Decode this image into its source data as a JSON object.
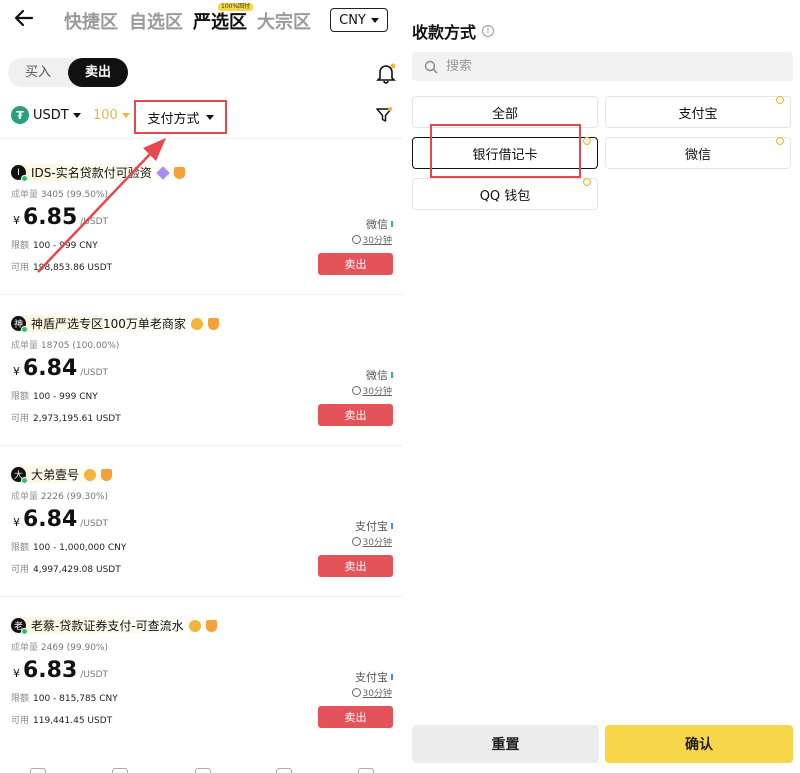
{
  "nav": {
    "tabs": [
      "快捷区",
      "自选区",
      "严选区",
      "大宗区"
    ],
    "active_tab": "严选区",
    "badge": "100%回付",
    "currency": "CNY"
  },
  "trade_toggle": {
    "buy": "买入",
    "sell": "卖出"
  },
  "filters": {
    "asset": "USDT",
    "amount": "100",
    "payment": "支付方式"
  },
  "ads": [
    {
      "avatar": "I",
      "name": "IDS-实名贷款付可验资",
      "stats_label": "成单量",
      "stats": "3405 (99.50%)",
      "currency_symbol": "¥",
      "price": "6.85",
      "unit": "/USDT",
      "limit_label": "限额",
      "limit": "100 - 999 CNY",
      "avail_label": "可用",
      "avail": "198,853.86 USDT",
      "method": "微信",
      "time": "30分钟",
      "action": "卖出"
    },
    {
      "avatar": "神",
      "name": "神盾严选专区100万单老商家",
      "stats_label": "成单量",
      "stats": "18705 (100.00%)",
      "currency_symbol": "¥",
      "price": "6.84",
      "unit": "/USDT",
      "limit_label": "限额",
      "limit": "100 - 999 CNY",
      "avail_label": "可用",
      "avail": "2,973,195.61 USDT",
      "method": "微信",
      "time": "30分钟",
      "action": "卖出"
    },
    {
      "avatar": "大",
      "name": "大弟壹号",
      "stats_label": "成单量",
      "stats": "2226 (99.30%)",
      "currency_symbol": "¥",
      "price": "6.84",
      "unit": "/USDT",
      "limit_label": "限额",
      "limit": "100 - 1,000,000 CNY",
      "avail_label": "可用",
      "avail": "4,997,429.08 USDT",
      "method": "支付宝",
      "time": "30分钟",
      "action": "卖出"
    },
    {
      "avatar": "老",
      "name": "老蔡-贷款证券支付-可查流水",
      "stats_label": "成单量",
      "stats": "2469 (99.90%)",
      "currency_symbol": "¥",
      "price": "6.83",
      "unit": "/USDT",
      "limit_label": "限额",
      "limit": "100 - 815,785 CNY",
      "avail_label": "可用",
      "avail": "119,441.45 USDT",
      "method": "支付宝",
      "time": "30分钟",
      "action": "卖出"
    }
  ],
  "payment_panel": {
    "title": "收款方式",
    "search_placeholder": "搜索",
    "options": [
      "全部",
      "支付宝",
      "银行借记卡",
      "微信",
      "QQ 钱包"
    ],
    "selected": "银行借记卡",
    "reset": "重置",
    "confirm": "确认"
  },
  "colors": {
    "sell_button": "#e5535a",
    "confirm_button": "#f7d64a",
    "highlight": "#e5484d",
    "accent_gold": "#e8b84a"
  }
}
